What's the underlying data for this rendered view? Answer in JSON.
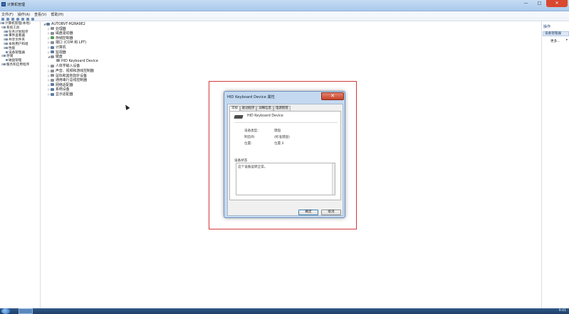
{
  "window": {
    "title": "计算机管理",
    "min": "—",
    "max": "□",
    "close": "✕"
  },
  "menu": [
    "文件(F)",
    "操作(A)",
    "查看(V)",
    "帮助(H)"
  ],
  "left_tree": [
    {
      "exp": "⊟",
      "label": "计算机管理(本地)"
    },
    {
      "exp": "⊟",
      "label": "系统工具"
    },
    {
      "exp": "⊞",
      "label": "任务计划程序"
    },
    {
      "exp": "⊞",
      "label": "事件查看器"
    },
    {
      "exp": "⊞",
      "label": "共享文件夹"
    },
    {
      "exp": "⊞",
      "label": "本地用户和组"
    },
    {
      "exp": "⊞",
      "label": "性能"
    },
    {
      "exp": "",
      "label": "设备管理器"
    },
    {
      "exp": "⊟",
      "label": "存储"
    },
    {
      "exp": "",
      "label": "磁盘管理"
    },
    {
      "exp": "⊞",
      "label": "服务和应用程序"
    }
  ],
  "device_tree": {
    "root": "AUTOBVT-M2RA9E2",
    "items": [
      {
        "exp": "▷",
        "label": "处理器"
      },
      {
        "exp": "▷",
        "label": "磁盘驱动器"
      },
      {
        "exp": "▷",
        "label": "存储控制器"
      },
      {
        "exp": "▷",
        "label": "端口 (COM 和 LPT)"
      },
      {
        "exp": "▷",
        "label": "计算机"
      },
      {
        "exp": "▷",
        "label": "监视器"
      },
      {
        "exp": "◢",
        "label": "键盘"
      },
      {
        "exp": "",
        "label": "HID Keyboard Device"
      },
      {
        "exp": "▷",
        "label": "人体学输入设备"
      },
      {
        "exp": "▷",
        "label": "声音、视频和游戏控制器"
      },
      {
        "exp": "▷",
        "label": "鼠标和其他指针设备"
      },
      {
        "exp": "▷",
        "label": "通用串行总线控制器"
      },
      {
        "exp": "▷",
        "label": "网络适配器"
      },
      {
        "exp": "▷",
        "label": "系统设备"
      },
      {
        "exp": "▷",
        "label": "显示适配器"
      }
    ]
  },
  "actions": {
    "title": "操作",
    "section": "设备管理器",
    "more": "更多..."
  },
  "dialog": {
    "title": "HID Keyboard Device 属性",
    "close": "✕",
    "tabs": [
      "常规",
      "驱动程序",
      "详细信息",
      "电源管理"
    ],
    "device_name": "HID Keyboard Device",
    "props": [
      {
        "label": "设备类型:",
        "value": "键盘"
      },
      {
        "label": "制造商:",
        "value": "(标准键盘)"
      },
      {
        "label": "位置:",
        "value": "位置 0"
      }
    ],
    "status_label": "设备状态",
    "status_text": "这个设备运转正常。",
    "ok": "确定",
    "cancel": "取消"
  },
  "taskbar": {
    "clock": "9:41"
  },
  "colors": {
    "highlight": "#d23a3a",
    "dialog_frame": "#c4d9f0",
    "close_button": "#c5432b"
  }
}
